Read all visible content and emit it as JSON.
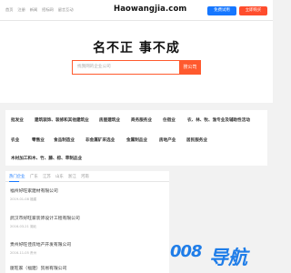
{
  "topbar": {
    "nav": [
      "首页",
      "注册",
      "新闻",
      "招标网",
      "留言互动"
    ],
    "site_name": "Haowangjia.com",
    "register_label": "免费试用",
    "login_label": "立即购买"
  },
  "hero": {
    "slogan": "名不正 事不成",
    "search_placeholder": "找我网的企业公司",
    "search_button": "搜公司"
  },
  "categories": [
    [
      "批发业",
      "建筑装饰、装修和其他建筑业",
      "房屋建筑业",
      "商务服务业",
      "住宿业",
      "农、林、牧、渔专业及辅助性活动"
    ],
    [
      "农业",
      "零售业",
      "食品制造业",
      "非金属矿采选业",
      "金属制品业",
      "房地产业",
      "居民服务业"
    ],
    [
      "木材加工和木、竹、藤、棕、草制品业"
    ]
  ],
  "news": {
    "tabs": [
      "热门企业",
      "广东",
      "江苏",
      "山东",
      "浙江",
      "河南"
    ],
    "items": [
      {
        "title": "福州好旺家建材有限公司",
        "meta": "2019-01-08 福建"
      },
      {
        "title": "武汉市好旺家装饰设计工程有限公司",
        "meta": "2016-03-21 湖北"
      },
      {
        "title": "贵州好旺佳房地产开发有限公司",
        "meta": "2016-11-05 贵州"
      },
      {
        "title": "厦旺家（福建）贸易有限公司",
        "meta": ""
      }
    ]
  },
  "watermark": {
    "logo": "008",
    "text": "导航"
  }
}
